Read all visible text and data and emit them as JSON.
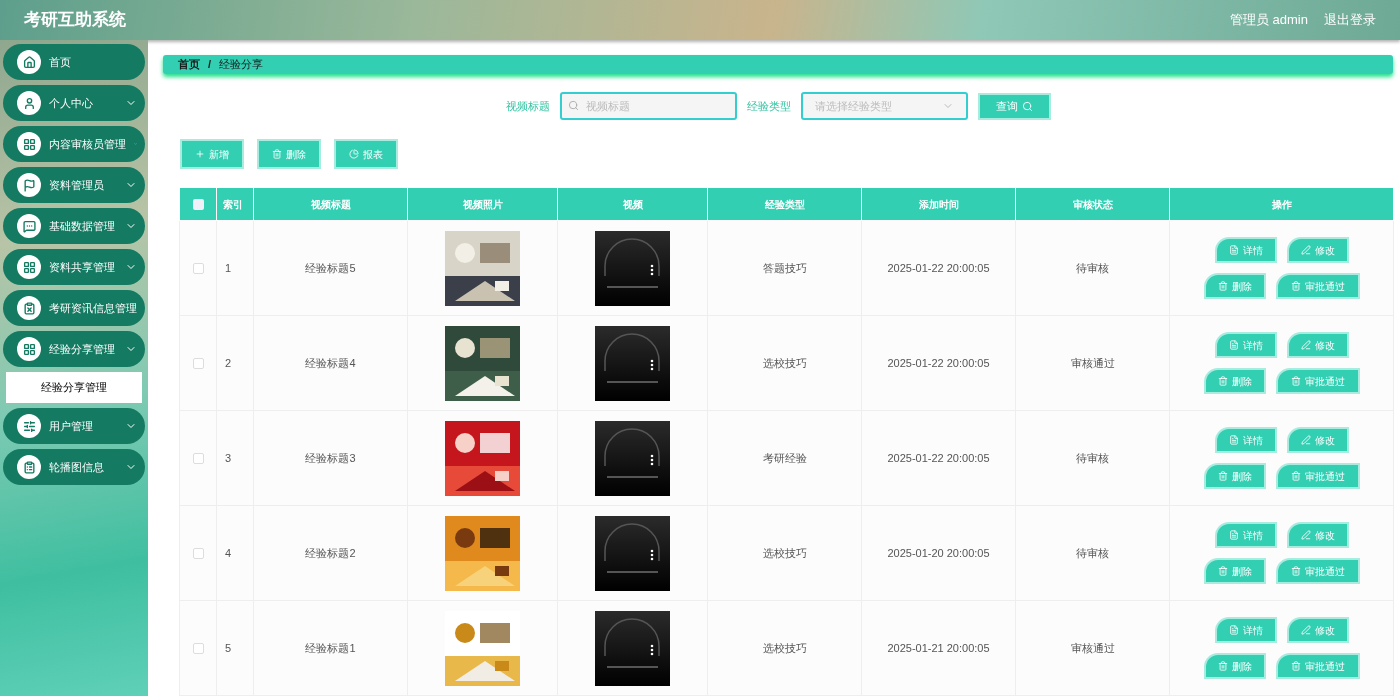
{
  "header": {
    "title": "考研互助系统",
    "user": "管理员 admin",
    "logout": "退出登录"
  },
  "sidebar": {
    "items": [
      {
        "label": "首页",
        "kind": "link"
      },
      {
        "label": "个人中心",
        "kind": "group"
      },
      {
        "label": "内容审核员管理",
        "kind": "group"
      },
      {
        "label": "资料管理员",
        "kind": "group"
      },
      {
        "label": "基础数据管理",
        "kind": "group"
      },
      {
        "label": "资料共享管理",
        "kind": "group"
      },
      {
        "label": "考研资讯信息管理",
        "kind": "group"
      },
      {
        "label": "经验分享管理",
        "kind": "group",
        "children": [
          {
            "label": "经验分享管理",
            "selected": true
          }
        ]
      },
      {
        "label": "用户管理",
        "kind": "group"
      },
      {
        "label": "轮播图信息",
        "kind": "group"
      }
    ]
  },
  "breadcrumb": [
    "首页",
    "/",
    "经验分享"
  ],
  "search": {
    "title_label": "视频标题",
    "title_placeholder": "视频标题",
    "type_label": "经验类型",
    "type_placeholder": "请选择经验类型",
    "query_button": "查询"
  },
  "toolbar": [
    {
      "label": "新增",
      "kind": "add"
    },
    {
      "label": "删除",
      "kind": "delete"
    },
    {
      "label": "报表",
      "kind": "report"
    }
  ],
  "table": {
    "select_all": {
      "checked": false
    },
    "columns": [
      "索引",
      "视频标题",
      "视频照片",
      "视频",
      "经验类型",
      "添加时间",
      "审核状态",
      "操作"
    ],
    "rows": [
      {
        "checked": false,
        "index": "1",
        "title": "经验标题5",
        "photo": {
          "kind": "picture"
        },
        "type": "答题技巧",
        "time": "2025-01-22 20:00:05",
        "status": "待审核",
        "actions": [
          {
            "label": "详情",
            "kind": "detail"
          },
          {
            "label": "修改",
            "kind": "edit"
          },
          {
            "label": "删除",
            "kind": "delete"
          },
          {
            "label": "审批通过",
            "kind": "approve"
          }
        ]
      },
      {
        "checked": false,
        "index": "2",
        "title": "经验标题4",
        "photo": {
          "kind": "picture"
        },
        "type": "选校技巧",
        "time": "2025-01-22 20:00:05",
        "status": "审核通过",
        "actions": [
          {
            "label": "详情",
            "kind": "detail"
          },
          {
            "label": "修改",
            "kind": "edit"
          },
          {
            "label": "删除",
            "kind": "delete"
          },
          {
            "label": "审批通过",
            "kind": "approve"
          }
        ]
      },
      {
        "checked": false,
        "index": "3",
        "title": "经验标题3",
        "photo": {
          "kind": "picture"
        },
        "type": "考研经验",
        "time": "2025-01-22 20:00:05",
        "status": "待审核",
        "actions": [
          {
            "label": "详情",
            "kind": "detail"
          },
          {
            "label": "修改",
            "kind": "edit"
          },
          {
            "label": "删除",
            "kind": "delete"
          },
          {
            "label": "审批通过",
            "kind": "approve"
          }
        ]
      },
      {
        "checked": false,
        "index": "4",
        "title": "经验标题2",
        "photo": {
          "kind": "picture"
        },
        "type": "选校技巧",
        "time": "2025-01-20 20:00:05",
        "status": "待审核",
        "actions": [
          {
            "label": "详情",
            "kind": "detail"
          },
          {
            "label": "修改",
            "kind": "edit"
          },
          {
            "label": "删除",
            "kind": "delete"
          },
          {
            "label": "审批通过",
            "kind": "approve"
          }
        ]
      },
      {
        "checked": false,
        "index": "5",
        "title": "经验标题1",
        "photo": {
          "kind": "picture"
        },
        "type": "选校技巧",
        "time": "2025-01-21 20:00:05",
        "status": "审核通过",
        "actions": [
          {
            "label": "详情",
            "kind": "detail"
          },
          {
            "label": "修改",
            "kind": "edit"
          },
          {
            "label": "删除",
            "kind": "delete"
          },
          {
            "label": "审批通过",
            "kind": "approve"
          }
        ]
      }
    ]
  }
}
